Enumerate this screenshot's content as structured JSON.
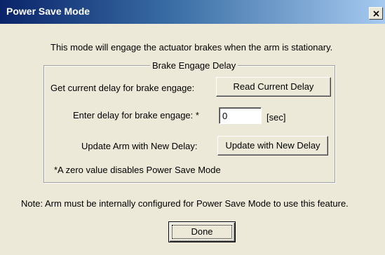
{
  "window": {
    "title": "Power Save Mode",
    "close_symbol": "X"
  },
  "description": "This mode will engage the actuator brakes when the arm is stationary.",
  "brake_group": {
    "legend": "Brake Engage Delay",
    "current_delay_label": "Get current delay for brake engage:",
    "read_button": "Read Current Delay",
    "enter_delay_label": "Enter delay for brake engage: *",
    "delay_value": "0",
    "delay_unit": "[sec]",
    "update_label": "Update Arm with New Delay:",
    "update_button": "Update with New Delay",
    "footnote": "*A zero value disables Power Save Mode"
  },
  "note": "Note: Arm must be internally configured for Power Save Mode to use this feature.",
  "done_button": "Done"
}
